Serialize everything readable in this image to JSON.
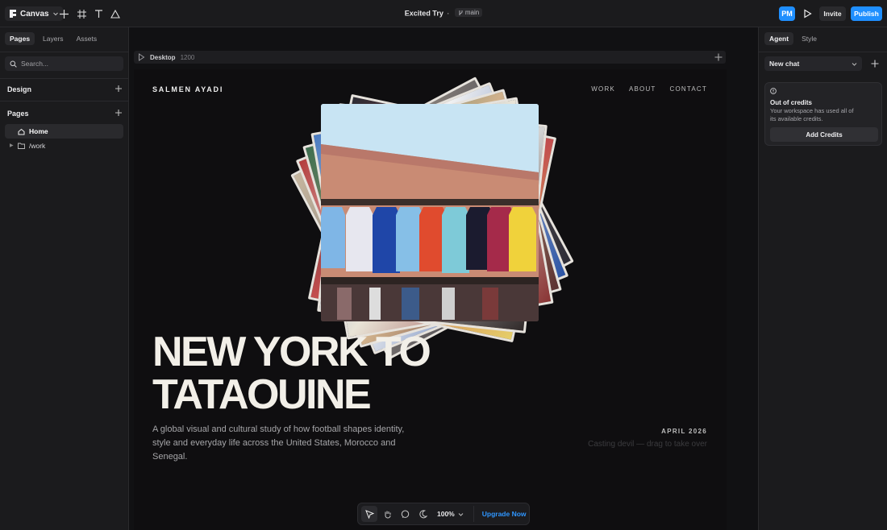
{
  "topbar": {
    "brand_label": "Canvas",
    "project_title": "Excited Try",
    "separator": "·",
    "branch": "main",
    "avatar_initials": "PM",
    "invite_label": "Invite",
    "publish_label": "Publish",
    "accent_color": "#1f8fff"
  },
  "left_panel": {
    "tabs": [
      {
        "label": "Pages",
        "active": true
      },
      {
        "label": "Layers",
        "active": false
      },
      {
        "label": "Assets",
        "active": false
      }
    ],
    "search_placeholder": "Search...",
    "design_title": "Design",
    "pages_title": "Pages",
    "pages": [
      {
        "label": "Home",
        "icon": "home-icon",
        "active": true
      },
      {
        "label": "/work",
        "icon": "folder-icon",
        "active": false
      }
    ]
  },
  "canvas": {
    "frame_name": "Desktop",
    "frame_width": "1200",
    "site": {
      "logo": "SALMEN AYADI",
      "nav": [
        "WORK",
        "ABOUT",
        "CONTACT"
      ],
      "hero_line1": "NEW YORK TO",
      "hero_line2": "TATAOUINE",
      "description": "A global visual and cultural study of how football shapes identity, style and everyday life across the United States, Morocco and Senegal.",
      "date": "APRIL 2026",
      "drag_hint": "Casting devil — drag to take over"
    },
    "toolbar": {
      "zoom": "100%",
      "upgrade_label": "Upgrade Now"
    }
  },
  "right_panel": {
    "tabs": [
      {
        "label": "Agent",
        "active": true
      },
      {
        "label": "Style",
        "active": false
      }
    ],
    "chat_select": "New chat",
    "credits_title": "Out of credits",
    "credits_desc": "Your workspace has used all of its available credits.",
    "credits_button": "Add Credits"
  }
}
